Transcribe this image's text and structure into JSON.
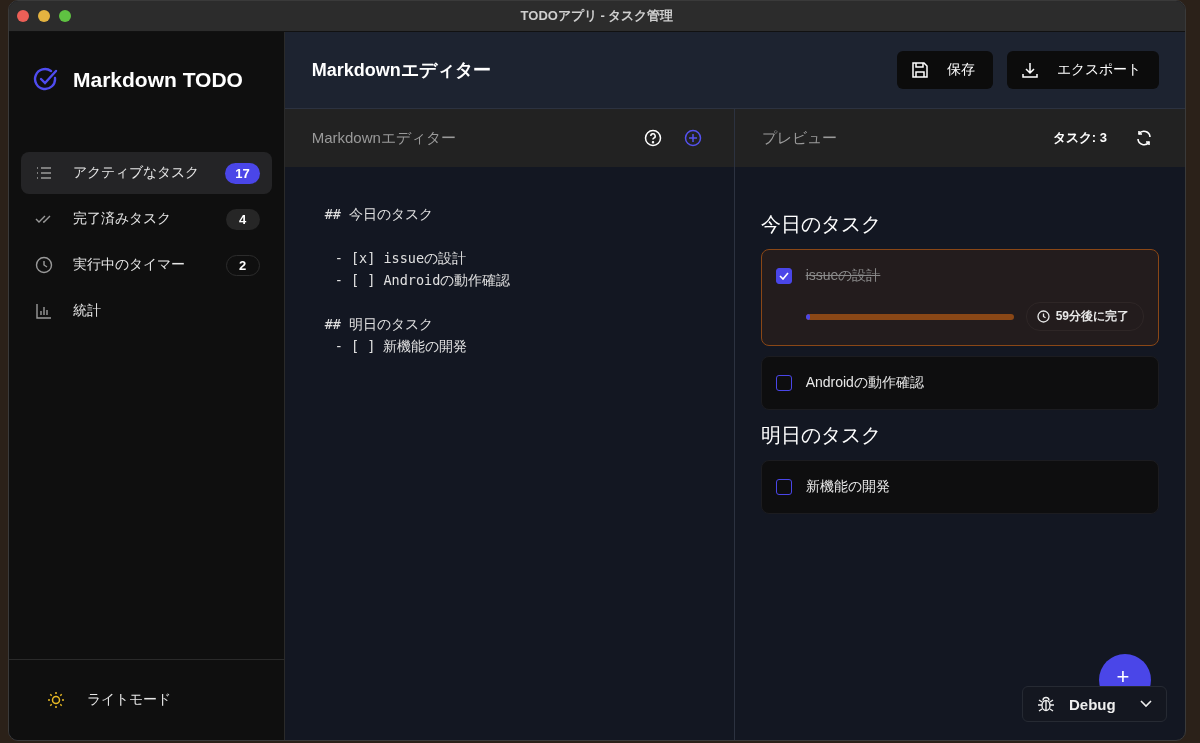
{
  "window": {
    "title": "TODOアプリ - タスク管理"
  },
  "sidebar": {
    "logo": "Markdown TODO",
    "items": [
      {
        "kind": "list",
        "label": "アクティブなタスク",
        "selected": true,
        "badge": {
          "text": "17",
          "kind": "accent"
        }
      },
      {
        "kind": "done",
        "label": "完了済みタスク",
        "selected": false,
        "badge": {
          "text": "4",
          "kind": "filled"
        }
      },
      {
        "kind": "clock",
        "label": "実行中のタイマー",
        "selected": false,
        "badge": {
          "text": "2",
          "kind": "outline"
        }
      },
      {
        "kind": "chart",
        "label": "統計",
        "selected": false
      }
    ],
    "theme_toggle": {
      "label": "ライトモード"
    }
  },
  "header": {
    "title": "Markdownエディター",
    "buttons": [
      {
        "kind": "save",
        "label": "保存"
      },
      {
        "kind": "export",
        "label": "エクスポート"
      }
    ]
  },
  "editor": {
    "title": "Markdownエディター",
    "lines": [
      {
        "kind": "heading",
        "text": "## 今日のタスク"
      },
      {
        "kind": "blank"
      },
      {
        "kind": "item",
        "text": "- [x] issueの設計"
      },
      {
        "kind": "item",
        "text": "- [ ] Androidの動作確認"
      },
      {
        "kind": "blank"
      },
      {
        "kind": "heading",
        "text": "## 明日のタスク"
      },
      {
        "kind": "item",
        "text": "- [ ] 新機能の開発"
      }
    ]
  },
  "preview": {
    "title": "プレビュー",
    "count": "タスク: 3",
    "sections": [
      {
        "heading": "今日のタスク",
        "tasks": [
          {
            "label": "issueの設計",
            "checked": true,
            "timer": {
              "level": 0.02,
              "reading": "59分後に完了"
            }
          },
          {
            "label": "Androidの動作確認",
            "checked": false
          }
        ]
      },
      {
        "heading": "明日のタスク",
        "tasks": [
          {
            "label": "新機能の開発",
            "checked": false
          }
        ]
      }
    ]
  },
  "fab": {
    "label": "+"
  },
  "debug": {
    "label": "Debug"
  }
}
